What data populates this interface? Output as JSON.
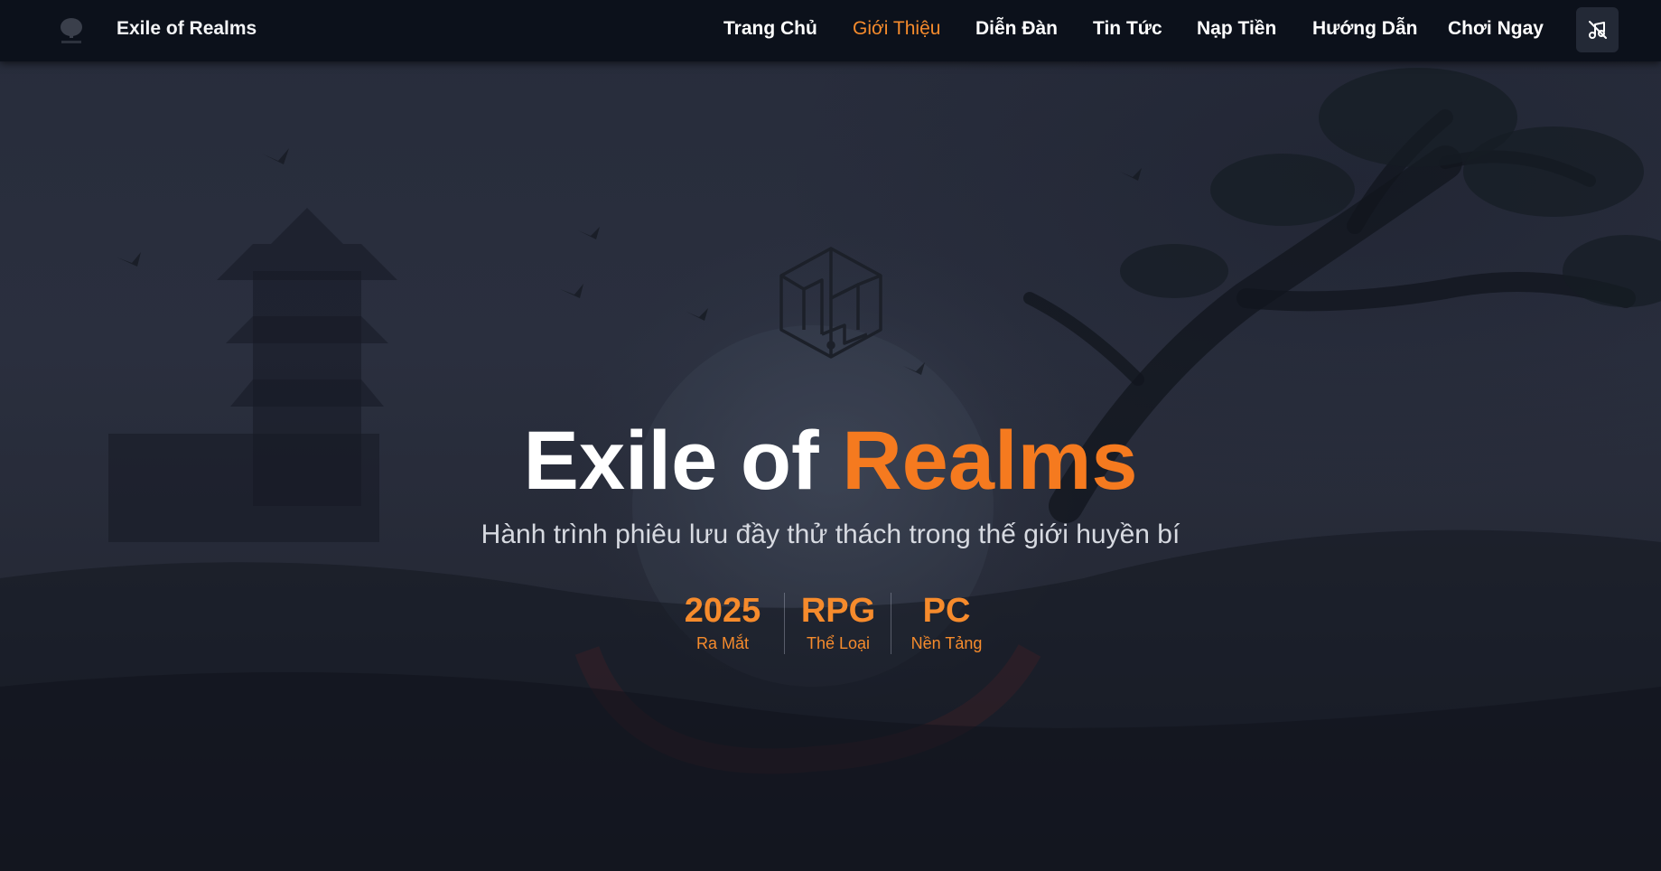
{
  "nav": {
    "brand_name": "Exile of Realms",
    "links": [
      {
        "label": "Trang Chủ",
        "active": false
      },
      {
        "label": "Giới Thiệu",
        "active": true
      },
      {
        "label": "Diễn Đàn",
        "active": false
      },
      {
        "label": "Tin Tức",
        "active": false
      },
      {
        "label": "Nạp Tiền",
        "active": false
      },
      {
        "label": "Hướng Dẫn",
        "active": false
      },
      {
        "label": "Chơi Ngay",
        "active": false
      }
    ],
    "music_button_icon": "music-off-icon"
  },
  "hero": {
    "logo_icon": "game-emblem-icon",
    "title_main": "Exile of ",
    "title_accent": "Realms",
    "subtitle": "Hành trình phiêu lưu đầy thử thách trong thế giới huyền bí",
    "stats": [
      {
        "value": "2025",
        "label": "Ra Mắt"
      },
      {
        "value": "RPG",
        "label": "Thể Loại"
      },
      {
        "value": "PC",
        "label": "Nền Tảng"
      }
    ]
  },
  "colors": {
    "accent": "#f57a1f",
    "nav_background": "#0c111b",
    "hero_background": "#272c3b"
  }
}
